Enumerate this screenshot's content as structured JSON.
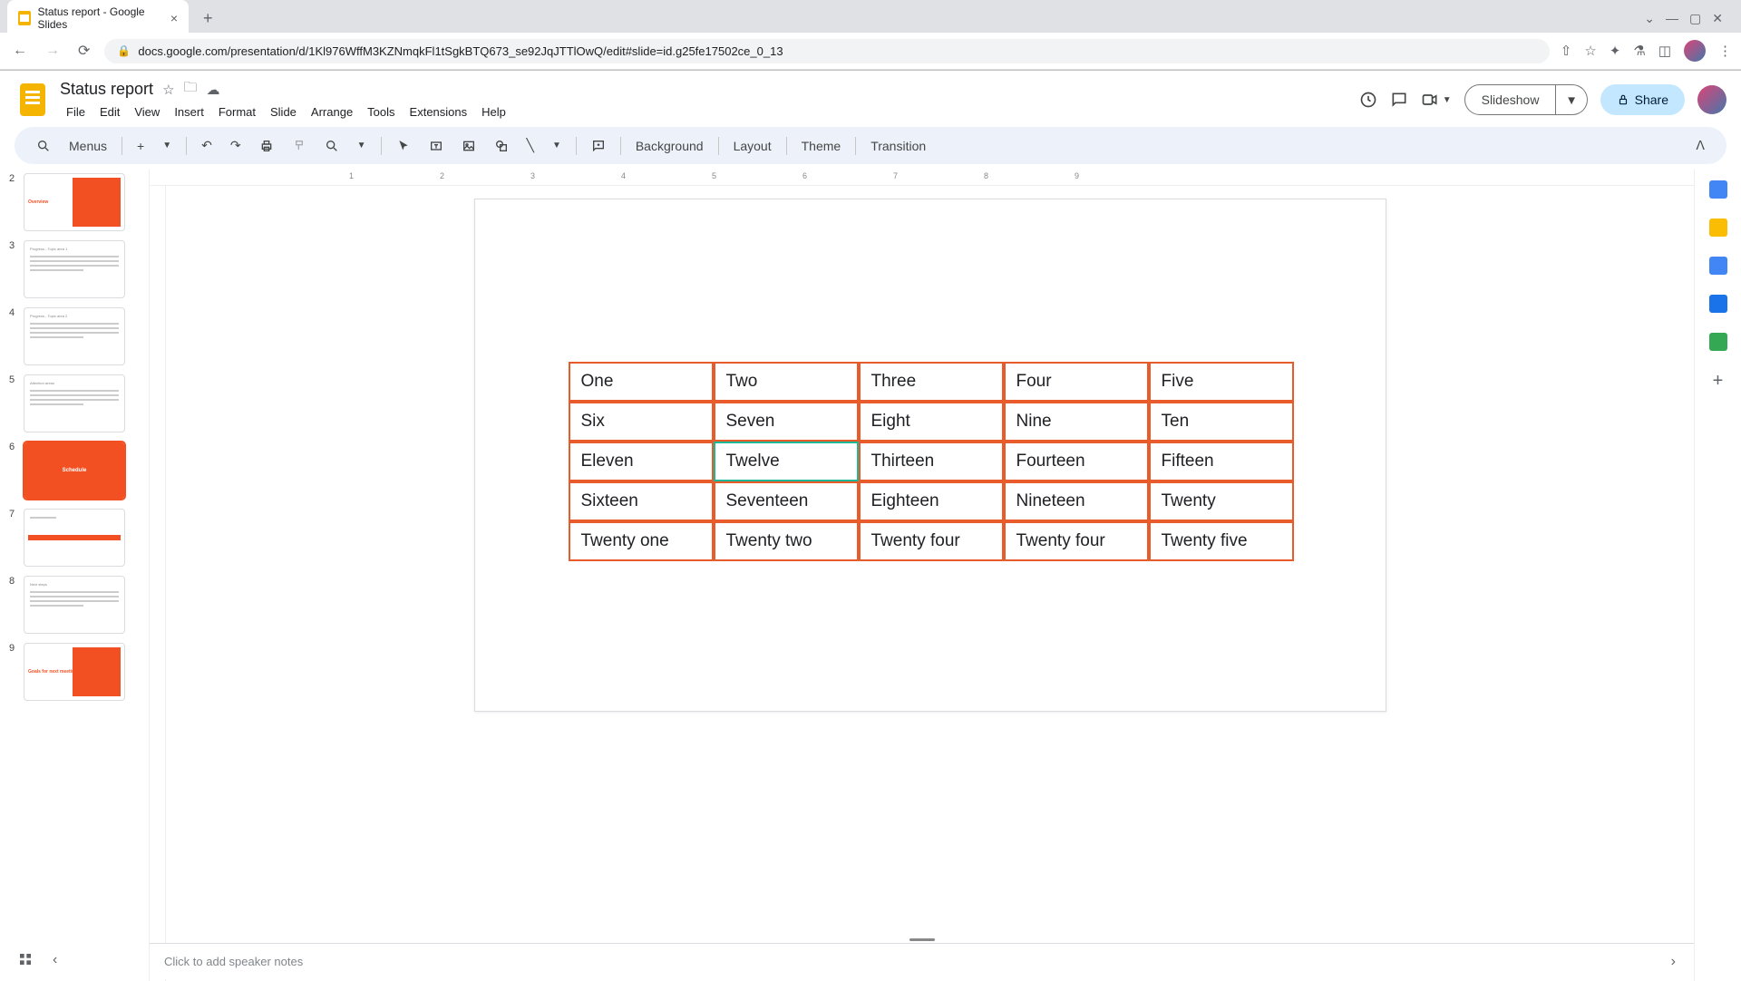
{
  "browser": {
    "tab_title": "Status report - Google Slides",
    "url": "docs.google.com/presentation/d/1Kl976WffM3KZNmqkFl1tSgkBTQ673_se92JqJTTlOwQ/edit#slide=id.g25fe17502ce_0_13"
  },
  "doc": {
    "title": "Status report"
  },
  "menus": [
    "File",
    "Edit",
    "View",
    "Insert",
    "Format",
    "Slide",
    "Arrange",
    "Tools",
    "Extensions",
    "Help"
  ],
  "toolbar": {
    "menus_label": "Menus",
    "background": "Background",
    "layout": "Layout",
    "theme": "Theme",
    "transition": "Transition"
  },
  "header_buttons": {
    "slideshow": "Slideshow",
    "share": "Share"
  },
  "ruler_labels": [
    "1",
    "2",
    "3",
    "4",
    "5",
    "6",
    "7",
    "8",
    "9"
  ],
  "thumbnails": [
    {
      "num": "2",
      "label": "Overview",
      "type": "half"
    },
    {
      "num": "3",
      "label": "Progress - Topic area 1",
      "type": "text"
    },
    {
      "num": "4",
      "label": "Progress - Topic area 2",
      "type": "text"
    },
    {
      "num": "5",
      "label": "Attention areas",
      "type": "text"
    },
    {
      "num": "6",
      "label": "Schedule",
      "type": "full",
      "active": true
    },
    {
      "num": "7",
      "label": "",
      "type": "timeline"
    },
    {
      "num": "8",
      "label": "Next steps",
      "type": "text"
    },
    {
      "num": "9",
      "label": "Goals for next meeting",
      "type": "half"
    }
  ],
  "table": {
    "rows": [
      [
        "One",
        "Two",
        "Three",
        "Four",
        "Five"
      ],
      [
        "Six",
        "Seven",
        "Eight",
        "Nine",
        "Ten"
      ],
      [
        "Eleven",
        "Twelve",
        "Thirteen",
        "Fourteen",
        "Fifteen"
      ],
      [
        "Sixteen",
        "Seventeen",
        "Eighteen",
        "Nineteen",
        "Twenty"
      ],
      [
        "Twenty one",
        "Twenty two",
        "Twenty four",
        "Twenty four",
        "Twenty five"
      ]
    ],
    "selected": {
      "row": 2,
      "col": 1
    }
  },
  "notes": {
    "placeholder": "Click to add speaker notes"
  }
}
